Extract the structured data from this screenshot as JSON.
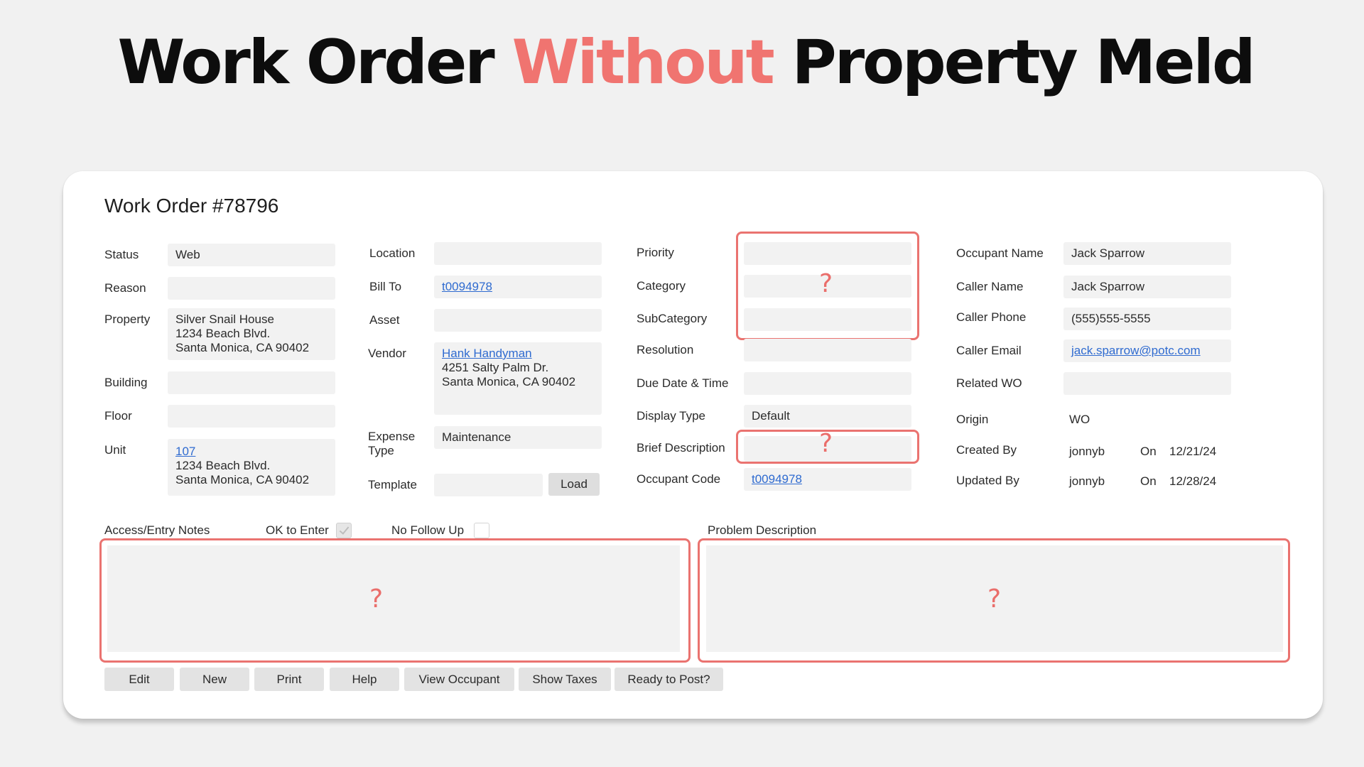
{
  "headline": {
    "part1": "Work Order ",
    "accent": "Without",
    "part2": " Property Meld"
  },
  "title": "Work Order #78796",
  "col1": {
    "status_label": "Status",
    "status_value": "Web",
    "reason_label": "Reason",
    "reason_value": "",
    "property_label": "Property",
    "property_lines": [
      "Silver Snail House",
      "1234 Beach Blvd.",
      "Santa Monica, CA 90402"
    ],
    "building_label": "Building",
    "building_value": "",
    "floor_label": "Floor",
    "floor_value": "",
    "unit_label": "Unit",
    "unit_link": "107",
    "unit_lines": [
      "1234 Beach Blvd.",
      "Santa Monica, CA 90402"
    ]
  },
  "col2": {
    "location_label": "Location",
    "location_value": "",
    "billto_label": "Bill To",
    "billto_link": "t0094978",
    "asset_label": "Asset",
    "asset_value": "",
    "vendor_label": "Vendor",
    "vendor_link": "Hank Handyman",
    "vendor_lines": [
      "4251 Salty Palm Dr.",
      "Santa Monica, CA 90402"
    ],
    "expense_label_1": "Expense",
    "expense_label_2": "Type",
    "expense_value": "Maintenance",
    "template_label": "Template",
    "template_value": "",
    "load_button": "Load"
  },
  "col3": {
    "priority_label": "Priority",
    "priority_value": "",
    "category_label": "Category",
    "category_value": "",
    "subcategory_label": "SubCategory",
    "subcategory_value": "",
    "resolution_label": "Resolution",
    "resolution_value": "",
    "due_label": "Due Date & Time",
    "due_value": "",
    "display_label": "Display Type",
    "display_value": "Default",
    "brief_label": "Brief Description",
    "brief_value": "",
    "occupant_code_label": "Occupant Code",
    "occupant_code_link": "t0094978",
    "unknown_mark": "?"
  },
  "col4": {
    "occupant_name_label": "Occupant Name",
    "occupant_name_value": "Jack Sparrow",
    "caller_name_label": "Caller Name",
    "caller_name_value": "Jack Sparrow",
    "caller_phone_label": "Caller Phone",
    "caller_phone_value": "(555)555-5555",
    "caller_email_label": "Caller Email",
    "caller_email_link": "jack.sparrow@potc.com",
    "related_label": "Related WO",
    "related_value": "",
    "origin_label": "Origin",
    "origin_value": "WO",
    "created_label": "Created By",
    "created_by": "jonnyb",
    "created_on_label": "On",
    "created_on": "12/21/24",
    "updated_label": "Updated By",
    "updated_by": "jonnyb",
    "updated_on_label": "On",
    "updated_on": "12/28/24"
  },
  "notes": {
    "access_label": "Access/Entry Notes",
    "ok_to_enter_label": "OK to Enter",
    "ok_to_enter_checked": true,
    "no_follow_up_label": "No Follow Up",
    "no_follow_up_checked": false,
    "problem_label": "Problem Description"
  },
  "buttons": [
    "Edit",
    "New",
    "Print",
    "Help",
    "View Occupant",
    "Show Taxes",
    "Ready to Post?"
  ],
  "colors": {
    "accent": "#f07470",
    "highlight_border": "#ea7370",
    "link": "#2f6bd0",
    "field_bg": "#f2f2f2"
  }
}
